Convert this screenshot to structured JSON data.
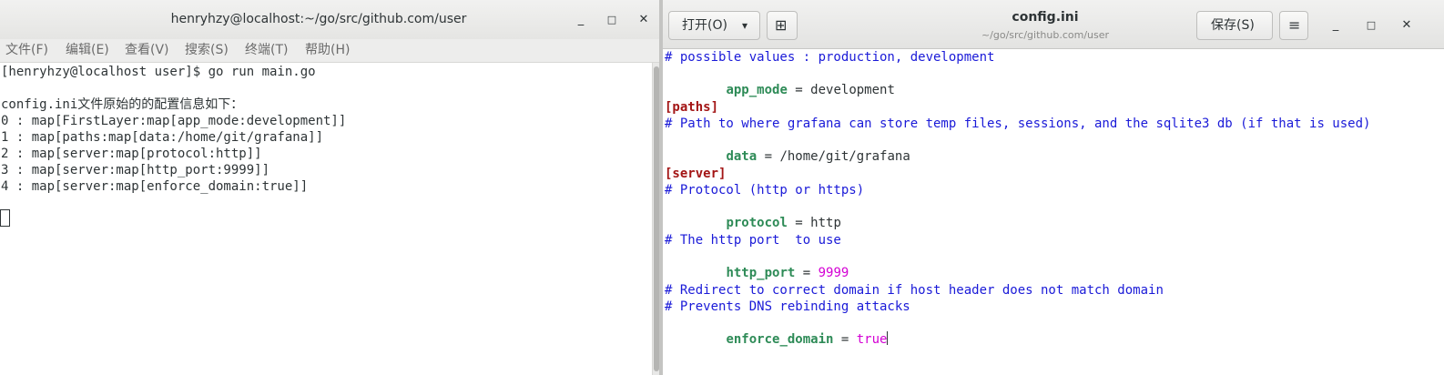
{
  "terminal": {
    "title": "henryhzy@localhost:~/go/src/github.com/user",
    "window_controls": {
      "minimize": "_",
      "maximize": "□",
      "close": "✕"
    },
    "menu": [
      "文件(F)",
      "编辑(E)",
      "查看(V)",
      "搜索(S)",
      "终端(T)",
      "帮助(H)"
    ],
    "lines": [
      "[henryhzy@localhost user]$ go run main.go",
      "",
      "config.ini文件原始的的配置信息如下：",
      "0 : map[FirstLayer:map[app_mode:development]]",
      "1 : map[paths:map[data:/home/git/grafana]]",
      "2 : map[server:map[protocol:http]]",
      "3 : map[server:map[http_port:9999]]",
      "4 : map[server:map[enforce_domain:true]]"
    ]
  },
  "editor": {
    "open_label": "打开(O)",
    "open_arrow": "▾",
    "new_tab_icon": "⊞",
    "title": "config.ini",
    "subtitle": "~/go/src/github.com/user",
    "save_label": "保存(S)",
    "menu_icon": "≡",
    "window_controls": {
      "minimize": "_",
      "maximize": "□",
      "close": "✕"
    },
    "code": {
      "l1": "# possible values : production, development",
      "l2_key": "app_mode",
      "l2_val": "development",
      "l4": "[paths]",
      "l5": "# Path to where grafana can store temp files, sessions, and the sqlite3 db (if that is used)",
      "l6_key": "data",
      "l6_val": "/home/git/grafana",
      "l8": "[server]",
      "l9": "# Protocol (http or https)",
      "l10_key": "protocol",
      "l10_val": "http",
      "l12": "# The http port  to use",
      "l13_key": "http_port",
      "l13_val": "9999",
      "l15": "# Redirect to correct domain if host header does not match domain",
      "l16": "# Prevents DNS rebinding attacks",
      "l17_key": "enforce_domain",
      "l17_val": "true",
      "equals": " = "
    }
  },
  "colors": {
    "comment": "#1a1ad8",
    "section": "#a31515",
    "key": "#2e8b57",
    "literal": "#d400d4"
  }
}
